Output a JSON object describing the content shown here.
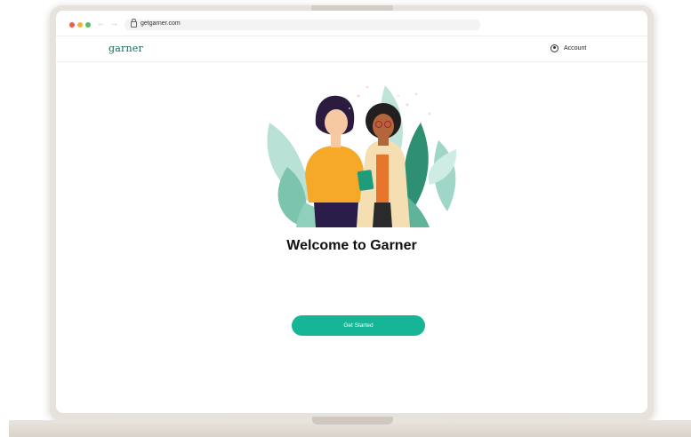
{
  "browser": {
    "url": "getgarner.com"
  },
  "header": {
    "logo": "garner",
    "account_label": "Account"
  },
  "main": {
    "heading": "Welcome to Garner",
    "cta_label": "Get Started"
  },
  "colors": {
    "brand": "#0c6b5a",
    "cta": "#15b596",
    "laptop": "#e7e2db"
  }
}
